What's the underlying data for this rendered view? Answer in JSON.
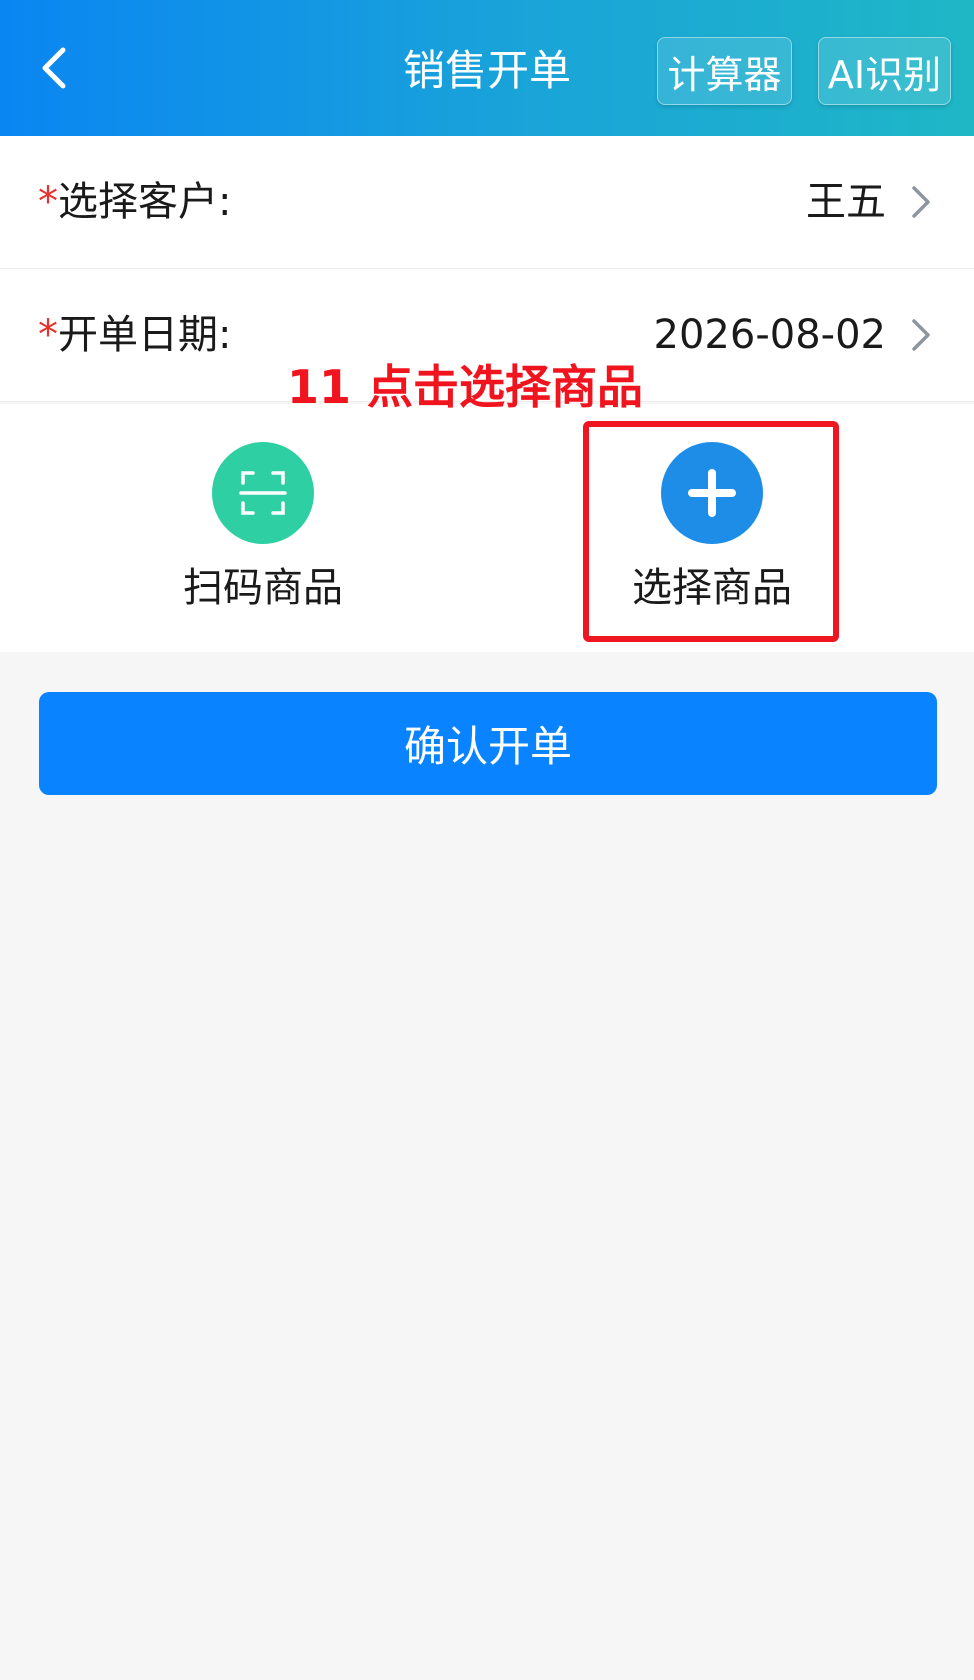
{
  "header": {
    "title": "销售开单",
    "calculator_label": "计算器",
    "ai_label": "AI识别",
    "icons": {
      "back": "back-arrow-icon"
    }
  },
  "form": {
    "required_mark": "*",
    "customer": {
      "label": "选择客户:",
      "value": "王五"
    },
    "date": {
      "label": "开单日期:",
      "value": "2026-08-02"
    }
  },
  "annotation": {
    "text": "11 点击选择商品",
    "color": "#f0141e"
  },
  "actions": {
    "scan": {
      "label": "扫码商品",
      "icon": "scan-icon",
      "color": "#2ecfa3"
    },
    "select": {
      "label": "选择商品",
      "icon": "plus-icon",
      "color": "#1e8de8"
    }
  },
  "confirm": {
    "label": "确认开单",
    "color": "#0983ff"
  }
}
